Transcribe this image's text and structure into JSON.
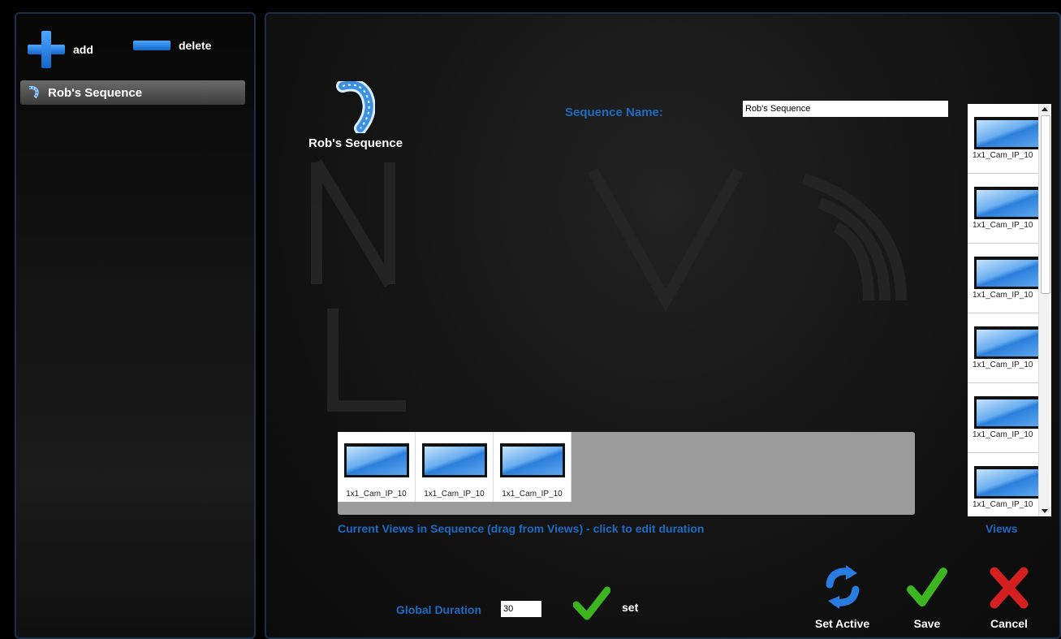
{
  "sidebar": {
    "add_label": "add",
    "delete_label": "delete",
    "items": [
      {
        "label": "Rob's Sequence"
      }
    ]
  },
  "editor": {
    "sequence_title": "Rob's Sequence",
    "name_label": "Sequence Name:",
    "name_value": "Rob's Sequence",
    "current_views": [
      {
        "label": "1x1_Cam_IP_10"
      },
      {
        "label": "1x1_Cam_IP_10"
      },
      {
        "label": "1x1_Cam_IP_10"
      }
    ],
    "current_caption": "Current Views in Sequence (drag from Views) - click to edit duration",
    "views": [
      {
        "label": "1x1_Cam_IP_10"
      },
      {
        "label": "1x1_Cam_IP_10"
      },
      {
        "label": "1x1_Cam_IP_10"
      },
      {
        "label": "1x1_Cam_IP_10"
      },
      {
        "label": "1x1_Cam_IP_10"
      },
      {
        "label": "1x1_Cam_IP_10"
      }
    ],
    "views_caption": "Views",
    "global_duration_label": "Global Duration",
    "global_duration_value": "30",
    "set_label": "set"
  },
  "actions": {
    "set_active": "Set Active",
    "save": "Save",
    "cancel": "Cancel"
  },
  "colors": {
    "accent_blue": "#1e6bc4",
    "check_green": "#3cb521",
    "cancel_red": "#d42020"
  }
}
